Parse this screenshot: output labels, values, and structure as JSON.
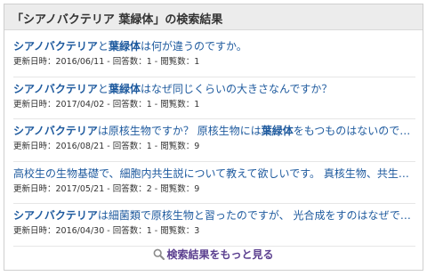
{
  "header": {
    "title": "「シアノバクテリア 葉緑体」の検索結果"
  },
  "results": [
    {
      "title_parts": [
        {
          "text": "シアノバクテリア",
          "bold": true
        },
        {
          "text": "と",
          "bold": false
        },
        {
          "text": "葉緑体",
          "bold": true
        },
        {
          "text": "は何が違うのですか。",
          "bold": false
        }
      ],
      "meta": "更新日時：2016/06/11 - 回答数：1 - 閲覧数：1"
    },
    {
      "title_parts": [
        {
          "text": "シアノバクテリア",
          "bold": true
        },
        {
          "text": "と",
          "bold": false
        },
        {
          "text": "葉緑体",
          "bold": true
        },
        {
          "text": "はなぜ同じくらいの大きさなんですか？",
          "bold": false
        }
      ],
      "meta": "更新日時：2017/04/02 - 回答数：1 - 閲覧数：1"
    },
    {
      "title_parts": [
        {
          "text": "シアノバクテリア",
          "bold": true
        },
        {
          "text": "は原核生物ですか？ 原核生物には",
          "bold": false
        },
        {
          "text": "葉緑体",
          "bold": true
        },
        {
          "text": "をもつものはないのです…",
          "bold": false
        }
      ],
      "meta": "更新日時：2016/08/21 - 回答数：1 - 閲覧数：9"
    },
    {
      "title_parts": [
        {
          "text": "高校生の生物基礎で、細胞内共生説について教えて欲しいです。 真核生物、共生、…",
          "bold": false
        }
      ],
      "meta": "更新日時：2017/05/21 - 回答数：2 - 閲覧数：9"
    },
    {
      "title_parts": [
        {
          "text": "シアノバクテリア",
          "bold": true
        },
        {
          "text": "は細菌類で原核生物と習ったのですが、 光合成をすのはなぜでし…",
          "bold": false
        }
      ],
      "meta": "更新日時：2016/04/30 - 回答数：1 - 閲覧数：3"
    }
  ],
  "more": {
    "label": "検索結果をもっと見る",
    "icon": "search-icon"
  },
  "colors": {
    "link": "#1e5a9e",
    "more": "#5b3f8f",
    "header_bg": "#ececec"
  }
}
